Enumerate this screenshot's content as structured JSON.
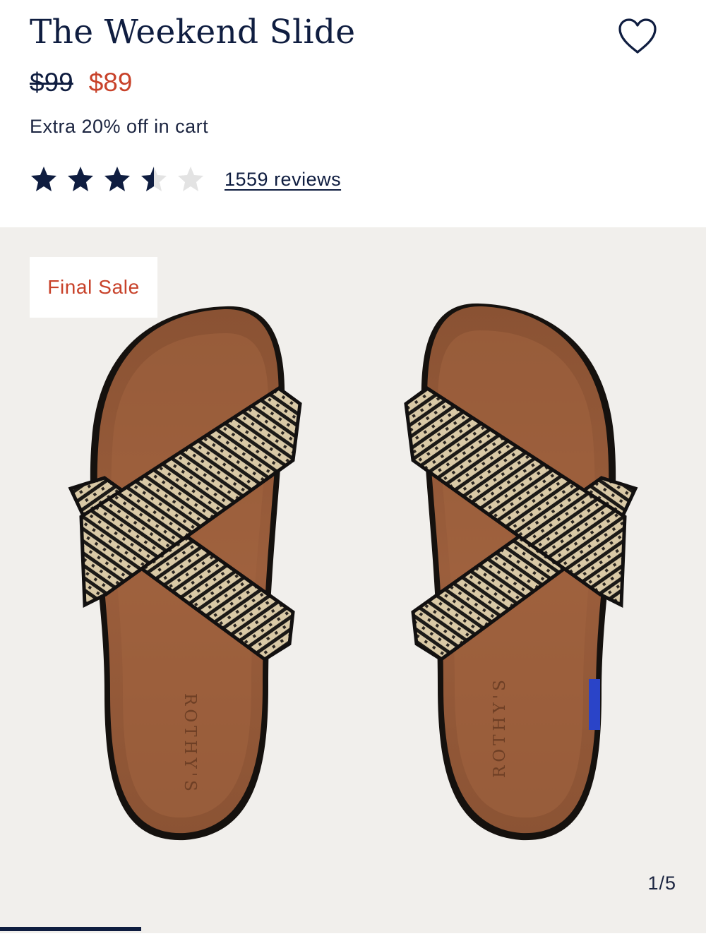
{
  "product": {
    "title": "The Weekend Slide",
    "original_price": "$99",
    "sale_price": "$89",
    "promo_text": "Extra 20% off in cart",
    "rating": 3.5,
    "rating_max": 5,
    "reviews_label": "1559 reviews"
  },
  "gallery": {
    "badge": "Final Sale",
    "counter": "1/5",
    "current_image": 1,
    "total_images": 5,
    "insole_brand": "ROTHY'S"
  },
  "icons": {
    "wishlist": "heart-outline-icon",
    "star_filled": "star-filled-icon",
    "star_empty": "star-empty-icon"
  },
  "colors": {
    "navy": "#0f1d40",
    "sale_red": "#c8422a",
    "gallery_bg": "#f1efec",
    "star_empty": "#e3e3e3"
  }
}
